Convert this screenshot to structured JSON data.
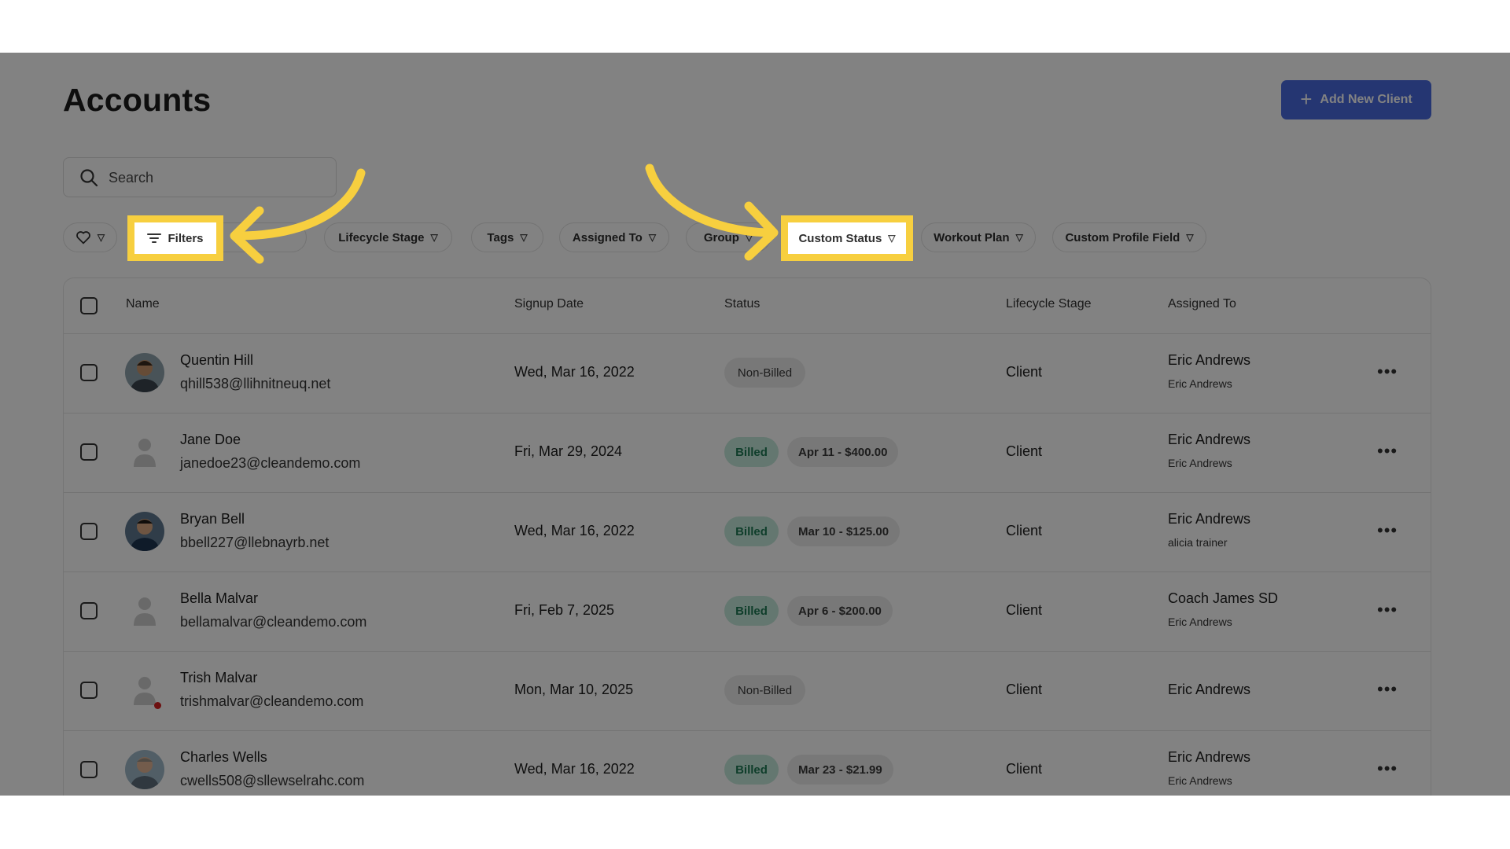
{
  "page": {
    "title": "Accounts"
  },
  "header": {
    "add_button_label": "Add New Client",
    "add_icon": "plus-icon"
  },
  "search": {
    "placeholder": "Search",
    "icon": "search-icon"
  },
  "filters": {
    "favorites_icon": "heart-icon",
    "filters_label": "Filters",
    "chips": [
      "Lifecycle Stage",
      "Tags",
      "Assigned To",
      "Group",
      "Custom Status",
      "Workout Plan",
      "Custom Profile Field"
    ]
  },
  "table": {
    "columns": [
      "Name",
      "Signup Date",
      "Status",
      "Lifecycle Stage",
      "Assigned To"
    ],
    "rows": [
      {
        "name": "Quentin Hill",
        "email": "qhill538@llihnitneuq.net",
        "signup_date": "Wed, Mar 16, 2022",
        "status": "Non-Billed",
        "amount": "",
        "lifecycle": "Client",
        "assigned_to": "Eric Andrews",
        "assigned_sub": "Eric Andrews"
      },
      {
        "name": "Jane Doe",
        "email": "janedoe23@cleandemo.com",
        "signup_date": "Fri, Mar 29, 2024",
        "status": "Billed",
        "amount": "Apr 11 - $400.00",
        "lifecycle": "Client",
        "assigned_to": "Eric Andrews",
        "assigned_sub": "Eric Andrews"
      },
      {
        "name": "Bryan Bell",
        "email": "bbell227@llebnayrb.net",
        "signup_date": "Wed, Mar 16, 2022",
        "status": "Billed",
        "amount": "Mar 10 - $125.00",
        "lifecycle": "Client",
        "assigned_to": "Eric Andrews",
        "assigned_sub": "alicia trainer"
      },
      {
        "name": "Bella Malvar",
        "email": "bellamalvar@cleandemo.com",
        "signup_date": "Fri, Feb 7, 2025",
        "status": "Billed",
        "amount": "Apr 6 - $200.00",
        "lifecycle": "Client",
        "assigned_to": "Coach James SD",
        "assigned_sub": "Eric Andrews"
      },
      {
        "name": "Trish Malvar",
        "email": "trishmalvar@cleandemo.com",
        "signup_date": "Mon, Mar 10, 2025",
        "status": "Non-Billed",
        "amount": "",
        "lifecycle": "Client",
        "assigned_to": "Eric Andrews",
        "assigned_sub": ""
      },
      {
        "name": "Charles Wells",
        "email": "cwells508@sllewselrahc.com",
        "signup_date": "Wed, Mar 16, 2022",
        "status": "Billed",
        "amount": "Mar 23 - $21.99",
        "lifecycle": "Client",
        "assigned_to": "Eric Andrews",
        "assigned_sub": "Eric Andrews"
      }
    ]
  },
  "colors": {
    "accent": "#4a6be0",
    "billed_bg": "#c5eadb",
    "billed_text": "#1f7a55",
    "highlight": "#f7cf3f",
    "dim_overlay": "rgba(0,0,0,0.49)"
  }
}
